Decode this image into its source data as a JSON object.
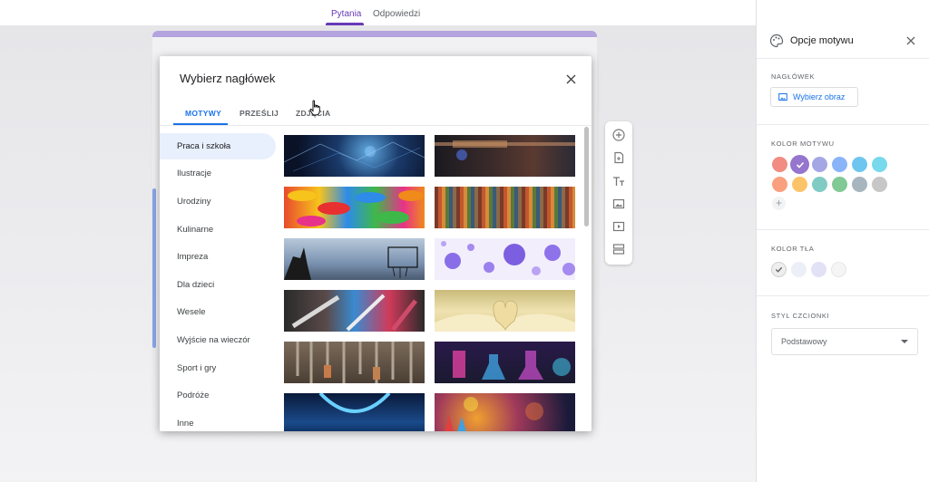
{
  "top_tabs": [
    {
      "label": "Pytania"
    },
    {
      "label": "Odpowiedzi"
    }
  ],
  "dialog": {
    "title": "Wybierz nagłówek",
    "tabs": [
      {
        "label": "MOTYWY"
      },
      {
        "label": "PRZEŚLIJ"
      },
      {
        "label": "ZDJĘCIA"
      }
    ],
    "categories": [
      {
        "label": "Praca i szkoła"
      },
      {
        "label": "Ilustracje"
      },
      {
        "label": "Urodziny"
      },
      {
        "label": "Kulinarne"
      },
      {
        "label": "Impreza"
      },
      {
        "label": "Dla dzieci"
      },
      {
        "label": "Wesele"
      },
      {
        "label": "Wyjście na wieczór"
      },
      {
        "label": "Sport i gry"
      },
      {
        "label": "Podróże"
      },
      {
        "label": "Inne"
      }
    ],
    "thumbnails": [
      "digital-network-image",
      "guitar-player-image",
      "colorful-candies-image",
      "colored-pencils-yarn-image",
      "basketball-hoop-image",
      "purple-bubbles-image",
      "painting-brushes-image",
      "open-book-heart-image",
      "workshop-tools-image",
      "science-flasks-image",
      "lab-glass-image",
      "colored-pencils-image"
    ]
  },
  "panel": {
    "title": "Opcje motywu",
    "header_section": "NAGŁÓWEK",
    "choose_image_label": "Wybierz obraz",
    "theme_color_section": "KOLOR MOTYWU",
    "theme_colors": [
      "#f28b82",
      "#9575cd",
      "#a5a7e4",
      "#8ab4f8",
      "#81c995",
      "#78d9ec",
      "#fba07f",
      "#fcc468",
      "#80cbc4",
      "#81c995",
      "#a7b5bf",
      "#c7c7c7"
    ],
    "bg_color_section": "KOLOR TŁA",
    "bg_colors": [
      "#eeeeee",
      "#eceef8",
      "#e3e1f6",
      "#f5f5f5"
    ],
    "font_section": "STYL CZCIONKI",
    "font_value": "Podstawowy"
  }
}
